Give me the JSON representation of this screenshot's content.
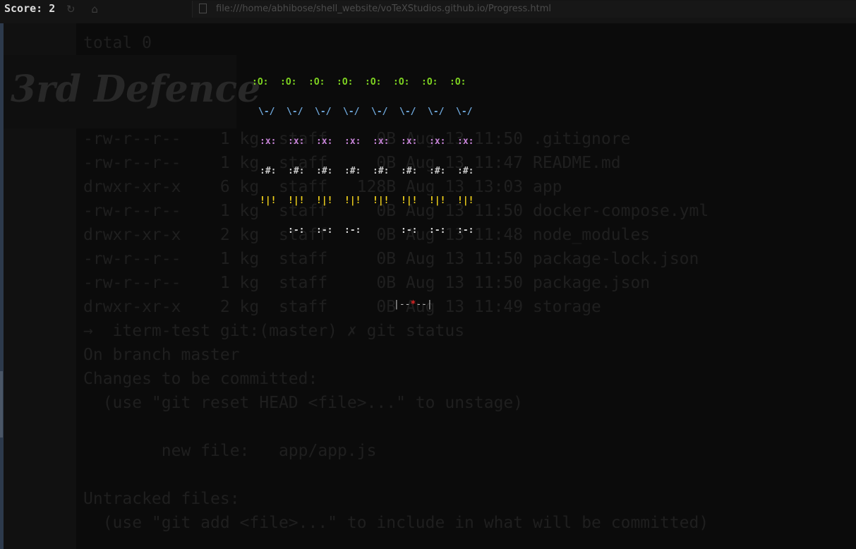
{
  "browser": {
    "url": "file:///home/abhibose/shell_website/voTeXStudios.github.io/Progress.html",
    "reload_icon": "reload-icon",
    "home_icon": "home-icon"
  },
  "hud": {
    "score_label": "Score:",
    "score_value": "2"
  },
  "level": {
    "title": "3rd Defence"
  },
  "terminal_backdrop": [
    "total 0",
    "",
    "",
    "",
    "-rw-r--r--    1 kg  staff     0B Aug 13 11:50 .gitignore",
    "-rw-r--r--    1 kg  staff     0B Aug 13 11:47 README.md",
    "drwxr-xr-x    6 kg  staff   128B Aug 13 13:03 app",
    "-rw-r--r--    1 kg  staff     0B Aug 13 11:50 docker-compose.yml",
    "drwxr-xr-x    2 kg  staff     0B Aug 13 11:48 node_modules",
    "-rw-r--r--    1 kg  staff     0B Aug 13 11:50 package-lock.json",
    "-rw-r--r--    1 kg  staff     0B Aug 13 11:50 package.json",
    "drwxr-xr-x    2 kg  staff     0B Aug 13 11:49 storage",
    "→  iterm-test git:(master) ✗ git status",
    "On branch master",
    "Changes to be committed:",
    "  (use \"git reset HEAD <file>...\" to unstage)",
    "",
    "        new file:   app/app.js",
    "",
    "Untracked files:",
    "  (use \"git add <file>...\" to include in what will be committed)"
  ],
  "invaders": {
    "rows": [
      {
        "glyph": ":O:",
        "color": "#7ed321",
        "count": 8
      },
      {
        "glyph": "\\-/",
        "color": "#6fa8dc",
        "count": 8
      },
      {
        "glyph": ":x:",
        "color": "#c583d6",
        "count": 8
      },
      {
        "glyph": ":#:",
        "color": "#c8c8c8",
        "count": 8
      },
      {
        "glyph": "!|!",
        "color": "#f2d21b",
        "count": 8
      },
      {
        "glyph": ":-:",
        "color": "#d9d9d9",
        "count": 6
      }
    ],
    "row_six_present": [
      true,
      true,
      true,
      false,
      true,
      true,
      true
    ]
  },
  "player": {
    "left": "|--",
    "core": "*",
    "right": "--|"
  }
}
